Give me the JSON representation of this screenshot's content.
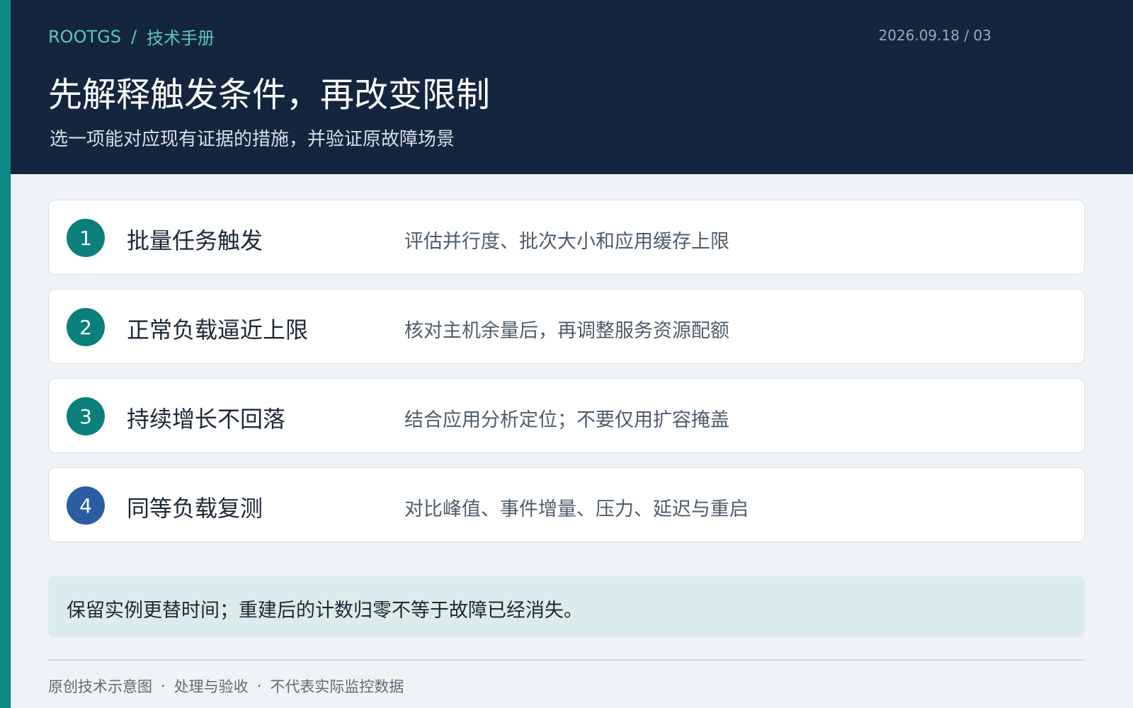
{
  "header": {
    "brand": "ROOTGS",
    "breadcrumb_sep": "/",
    "section": "技术手册",
    "page_meta": "2026.09.18 / 03",
    "title": "先解释触发条件，再改变限制",
    "subtitle": "选一项能对应现有证据的措施，并验证原故障场景"
  },
  "steps": [
    {
      "num": "1",
      "title": "批量任务触发",
      "desc": "评估并行度、批次大小和应用缓存上限"
    },
    {
      "num": "2",
      "title": "正常负载逼近上限",
      "desc": "核对主机余量后，再调整服务资源配额"
    },
    {
      "num": "3",
      "title": "持续增长不回落",
      "desc": "结合应用分析定位；不要仅用扩容掩盖"
    },
    {
      "num": "4",
      "title": "同等负载复测",
      "desc": "对比峰值、事件增量、压力、延迟与重启"
    }
  ],
  "note": "保留实例更替时间；重建后的计数归零不等于故障已经消失。",
  "footer": {
    "item1": "原创技术示意图",
    "item2": "处理与验收",
    "item3": "不代表实际监控数据",
    "dot": "·"
  },
  "colors": {
    "accent": "#0d8a84",
    "header_bg": "#14263f",
    "step_teal": "#0b7f7c",
    "step_blue": "#2a5ea3",
    "note_bg": "#dcebeb"
  }
}
